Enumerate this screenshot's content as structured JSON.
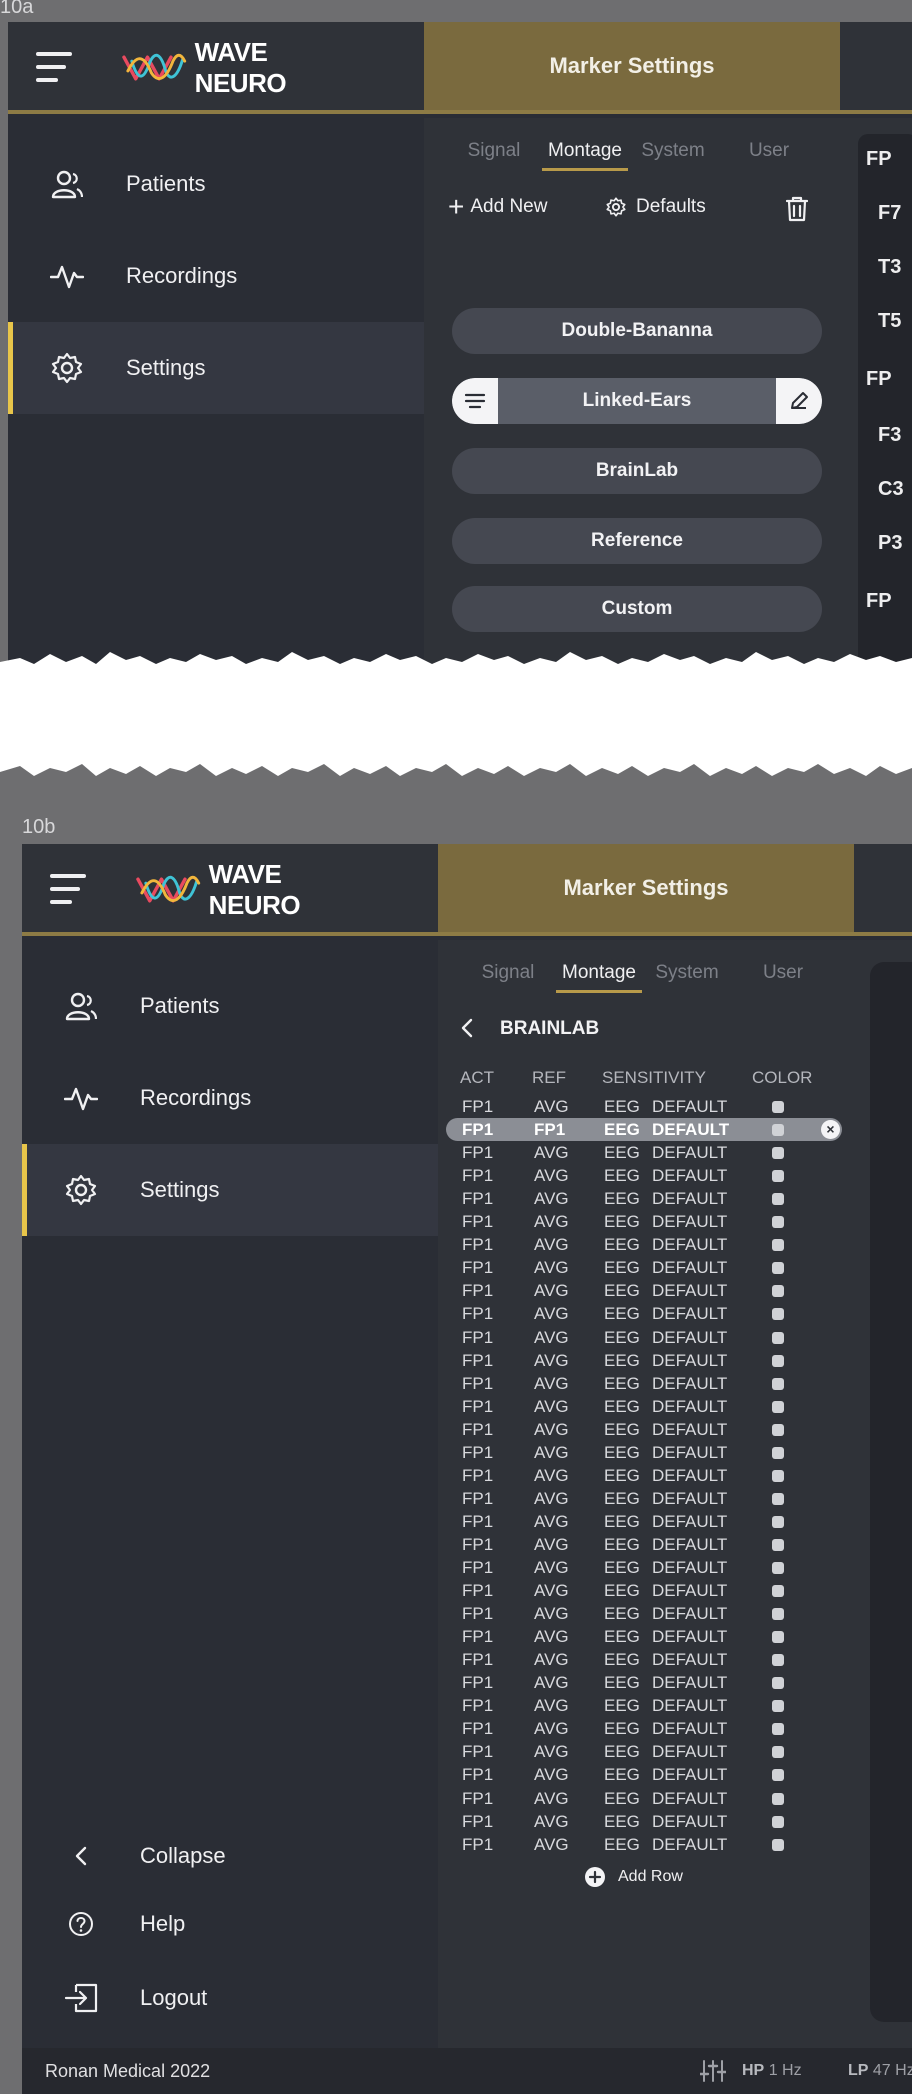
{
  "frames": {
    "a_label": "10a",
    "b_label": "10b"
  },
  "app": {
    "logo_text": "WAVE NEURO",
    "header_title": "Marker Settings"
  },
  "sidebar": {
    "items": [
      {
        "label": "Patients",
        "icon": "user-icon"
      },
      {
        "label": "Recordings",
        "icon": "pulse-icon"
      },
      {
        "label": "Settings",
        "icon": "gear-icon"
      }
    ],
    "bottom": [
      {
        "label": "Collapse",
        "icon": "chevron-left-icon"
      },
      {
        "label": "Help",
        "icon": "help-icon"
      },
      {
        "label": "Logout",
        "icon": "logout-icon"
      }
    ]
  },
  "tabs": [
    "Signal",
    "Montage",
    "System",
    "User"
  ],
  "active_tab": "Montage",
  "toolbar": {
    "add_new": "Add New",
    "defaults": "Defaults"
  },
  "montages": [
    "Double-Bananna",
    "Linked-Ears",
    "BrainLab",
    "Reference",
    "Custom"
  ],
  "selected_montage": "Linked-Ears",
  "detail": {
    "title": "BRAINLAB",
    "columns": [
      "ACT",
      "REF",
      "SENSITIVITY",
      "COLOR"
    ],
    "rows": [
      [
        "FP1",
        "AVG",
        "EEG",
        "DEFAULT"
      ],
      [
        "FP1",
        "FP1",
        "EEG",
        "DEFAULT"
      ],
      [
        "FP1",
        "AVG",
        "EEG",
        "DEFAULT"
      ],
      [
        "FP1",
        "AVG",
        "EEG",
        "DEFAULT"
      ],
      [
        "FP1",
        "AVG",
        "EEG",
        "DEFAULT"
      ],
      [
        "FP1",
        "AVG",
        "EEG",
        "DEFAULT"
      ],
      [
        "FP1",
        "AVG",
        "EEG",
        "DEFAULT"
      ],
      [
        "FP1",
        "AVG",
        "EEG",
        "DEFAULT"
      ],
      [
        "FP1",
        "AVG",
        "EEG",
        "DEFAULT"
      ],
      [
        "FP1",
        "AVG",
        "EEG",
        "DEFAULT"
      ],
      [
        "FP1",
        "AVG",
        "EEG",
        "DEFAULT"
      ],
      [
        "FP1",
        "AVG",
        "EEG",
        "DEFAULT"
      ],
      [
        "FP1",
        "AVG",
        "EEG",
        "DEFAULT"
      ],
      [
        "FP1",
        "AVG",
        "EEG",
        "DEFAULT"
      ],
      [
        "FP1",
        "AVG",
        "EEG",
        "DEFAULT"
      ],
      [
        "FP1",
        "AVG",
        "EEG",
        "DEFAULT"
      ],
      [
        "FP1",
        "AVG",
        "EEG",
        "DEFAULT"
      ],
      [
        "FP1",
        "AVG",
        "EEG",
        "DEFAULT"
      ],
      [
        "FP1",
        "AVG",
        "EEG",
        "DEFAULT"
      ],
      [
        "FP1",
        "AVG",
        "EEG",
        "DEFAULT"
      ],
      [
        "FP1",
        "AVG",
        "EEG",
        "DEFAULT"
      ],
      [
        "FP1",
        "AVG",
        "EEG",
        "DEFAULT"
      ],
      [
        "FP1",
        "AVG",
        "EEG",
        "DEFAULT"
      ],
      [
        "FP1",
        "AVG",
        "EEG",
        "DEFAULT"
      ],
      [
        "FP1",
        "AVG",
        "EEG",
        "DEFAULT"
      ],
      [
        "FP1",
        "AVG",
        "EEG",
        "DEFAULT"
      ],
      [
        "FP1",
        "AVG",
        "EEG",
        "DEFAULT"
      ],
      [
        "FP1",
        "AVG",
        "EEG",
        "DEFAULT"
      ],
      [
        "FP1",
        "AVG",
        "EEG",
        "DEFAULT"
      ],
      [
        "FP1",
        "AVG",
        "EEG",
        "DEFAULT"
      ],
      [
        "FP1",
        "AVG",
        "EEG",
        "DEFAULT"
      ],
      [
        "FP1",
        "AVG",
        "EEG",
        "DEFAULT"
      ],
      [
        "FP1",
        "AVG",
        "EEG",
        "DEFAULT"
      ]
    ],
    "highlighted_row": 1,
    "add_row": "Add Row"
  },
  "ghost_channels_a": [
    "FP",
    "F7",
    "T3",
    "T5",
    "FP",
    "F3",
    "C3",
    "P3",
    "FP"
  ],
  "footer": {
    "copyright": "Ronan Medical 2022",
    "hp_label": "HP",
    "hp_value": "1 Hz",
    "lp_label": "LP",
    "lp_value": "47 Hz"
  },
  "colors": {
    "accent_gold": "#8d7b45",
    "active_bar": "#e8c54a",
    "panel_bg": "#2a2d35"
  }
}
